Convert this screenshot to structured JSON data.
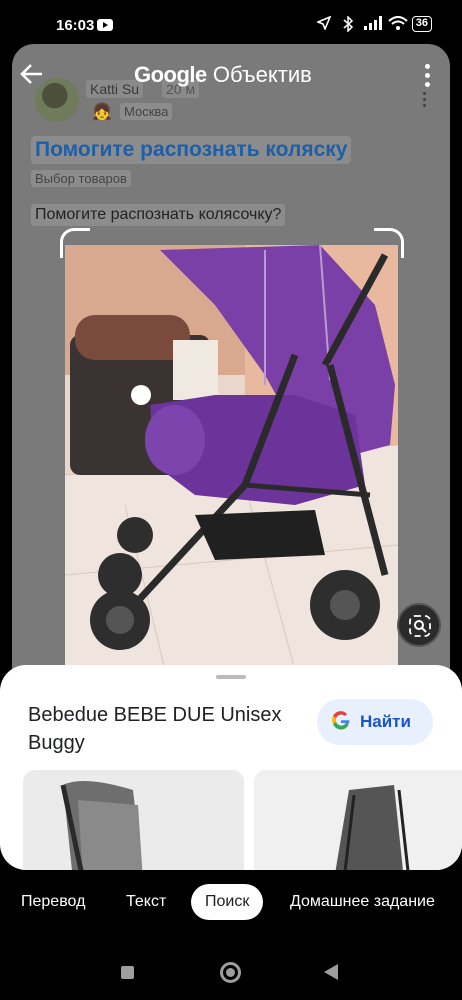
{
  "status_bar": {
    "time": "16:03",
    "battery": "36",
    "icons": [
      "youtube-icon",
      "location-icon",
      "bluetooth-icon",
      "signal-icon",
      "wifi-icon",
      "battery-icon"
    ]
  },
  "lens_header": {
    "google": "Google",
    "title": "Объектив"
  },
  "forum_post": {
    "author": "Katti Su",
    "ago": "20 м",
    "city": "Москва",
    "title": "Помогите распознать коляску",
    "category": "Выбор товаров",
    "question": "Помогите распознать колясочку?"
  },
  "result": {
    "title": "Bebedue BEBE DUE Unisex Buggy",
    "find_label": "Найти",
    "google_g": "G"
  },
  "tabs": [
    {
      "label": "Перевод"
    },
    {
      "label": "Текст"
    },
    {
      "label": "Поиск"
    },
    {
      "label": "Домашнее задание"
    }
  ],
  "colors": {
    "accent_blue": "#1a56c8",
    "link_title": "#1d5fa8",
    "stroller_purple": "#7b3fa8",
    "find_bg": "#e8f0fe"
  }
}
